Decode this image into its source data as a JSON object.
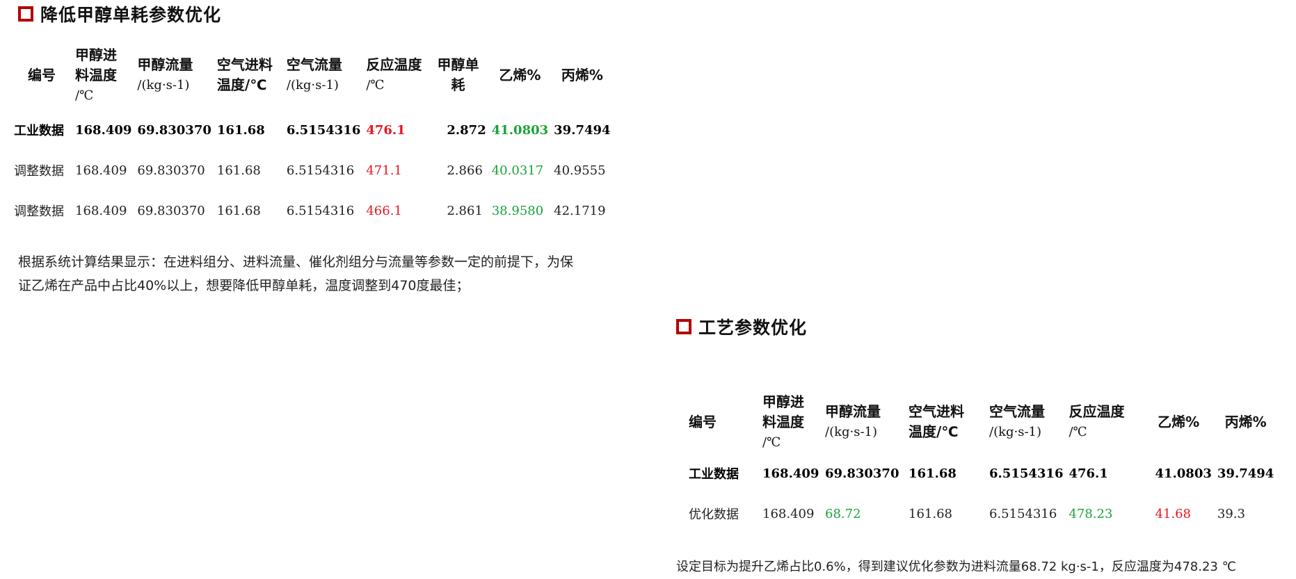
{
  "section1": {
    "title": "降低甲醇单耗参数优化",
    "headers": {
      "id": "编号",
      "feed_temp_1": "甲醇进",
      "feed_temp_2": "料温度",
      "feed_temp_unit": "/℃",
      "methanol_flow_1": "甲醇流量",
      "methanol_flow_unit": "/(kg·s-1)",
      "air_temp_1": "空气进料",
      "air_temp_2": "温度/℃",
      "air_flow_1": "空气流量",
      "air_flow_unit": "/(kg·s-1)",
      "reaction_temp_1": "反应温度",
      "reaction_temp_unit": "/℃",
      "consumption_1": "甲醇单",
      "consumption_2": "耗",
      "ethylene": "乙烯%",
      "propylene": "丙烯%"
    },
    "rows": [
      {
        "label": "工业数据",
        "feed_temp": "168.409",
        "methanol_flow": "69.830370",
        "air_temp": "161.68",
        "air_flow": "6.5154316",
        "reaction_temp": "476.1",
        "consumption": "2.872",
        "ethylene": "41.0803",
        "propylene": "39.7494"
      },
      {
        "label": "调整数据",
        "feed_temp": "168.409",
        "methanol_flow": "69.830370",
        "air_temp": "161.68",
        "air_flow": "6.5154316",
        "reaction_temp": "471.1",
        "consumption": "2.866",
        "ethylene": "40.0317",
        "propylene": "40.9555"
      },
      {
        "label": "调整数据",
        "feed_temp": "168.409",
        "methanol_flow": "69.830370",
        "air_temp": "161.68",
        "air_flow": "6.5154316",
        "reaction_temp": "466.1",
        "consumption": "2.861",
        "ethylene": "38.9580",
        "propylene": "42.1719"
      }
    ],
    "note_line1": "根据系统计算结果显示：在进料组分、进料流量、催化剂组分与流量等参数一定的前提下，为保",
    "note_line2": "证乙烯在产品中占比40%以上，想要降低甲醇单耗，温度调整到470度最佳；"
  },
  "section2": {
    "title": "工艺参数优化",
    "headers": {
      "id": "编号",
      "feed_temp_1": "甲醇进",
      "feed_temp_2": "料温度",
      "feed_temp_unit": "/℃",
      "methanol_flow_1": "甲醇流量",
      "methanol_flow_unit": "/(kg·s-1)",
      "air_temp_1": "空气进料",
      "air_temp_2": "温度/℃",
      "air_flow_1": "空气流量",
      "air_flow_unit": "/(kg·s-1)",
      "reaction_temp_1": "反应温度",
      "reaction_temp_unit": "/℃",
      "ethylene": "乙烯%",
      "propylene": "丙烯%"
    },
    "rows": [
      {
        "label": "工业数据",
        "feed_temp": "168.409",
        "methanol_flow": "69.830370",
        "air_temp": "161.68",
        "air_flow": "6.5154316",
        "reaction_temp": "476.1",
        "ethylene": "41.0803",
        "propylene": "39.7494"
      },
      {
        "label": "优化数据",
        "feed_temp": "168.409",
        "methanol_flow": "68.72",
        "air_temp": "161.68",
        "air_flow": "6.5154316",
        "reaction_temp": "478.23",
        "ethylene": "41.68",
        "propylene": "39.3"
      }
    ],
    "note": "设定目标为提升乙烯占比0.6%，得到建议优化参数为进料流量68.72 kg·s-1，反应温度为478.23 ℃"
  },
  "colors": {
    "accent_red": "#e8141e",
    "accent_green": "#1aa33a",
    "title_box": "#b30000"
  }
}
